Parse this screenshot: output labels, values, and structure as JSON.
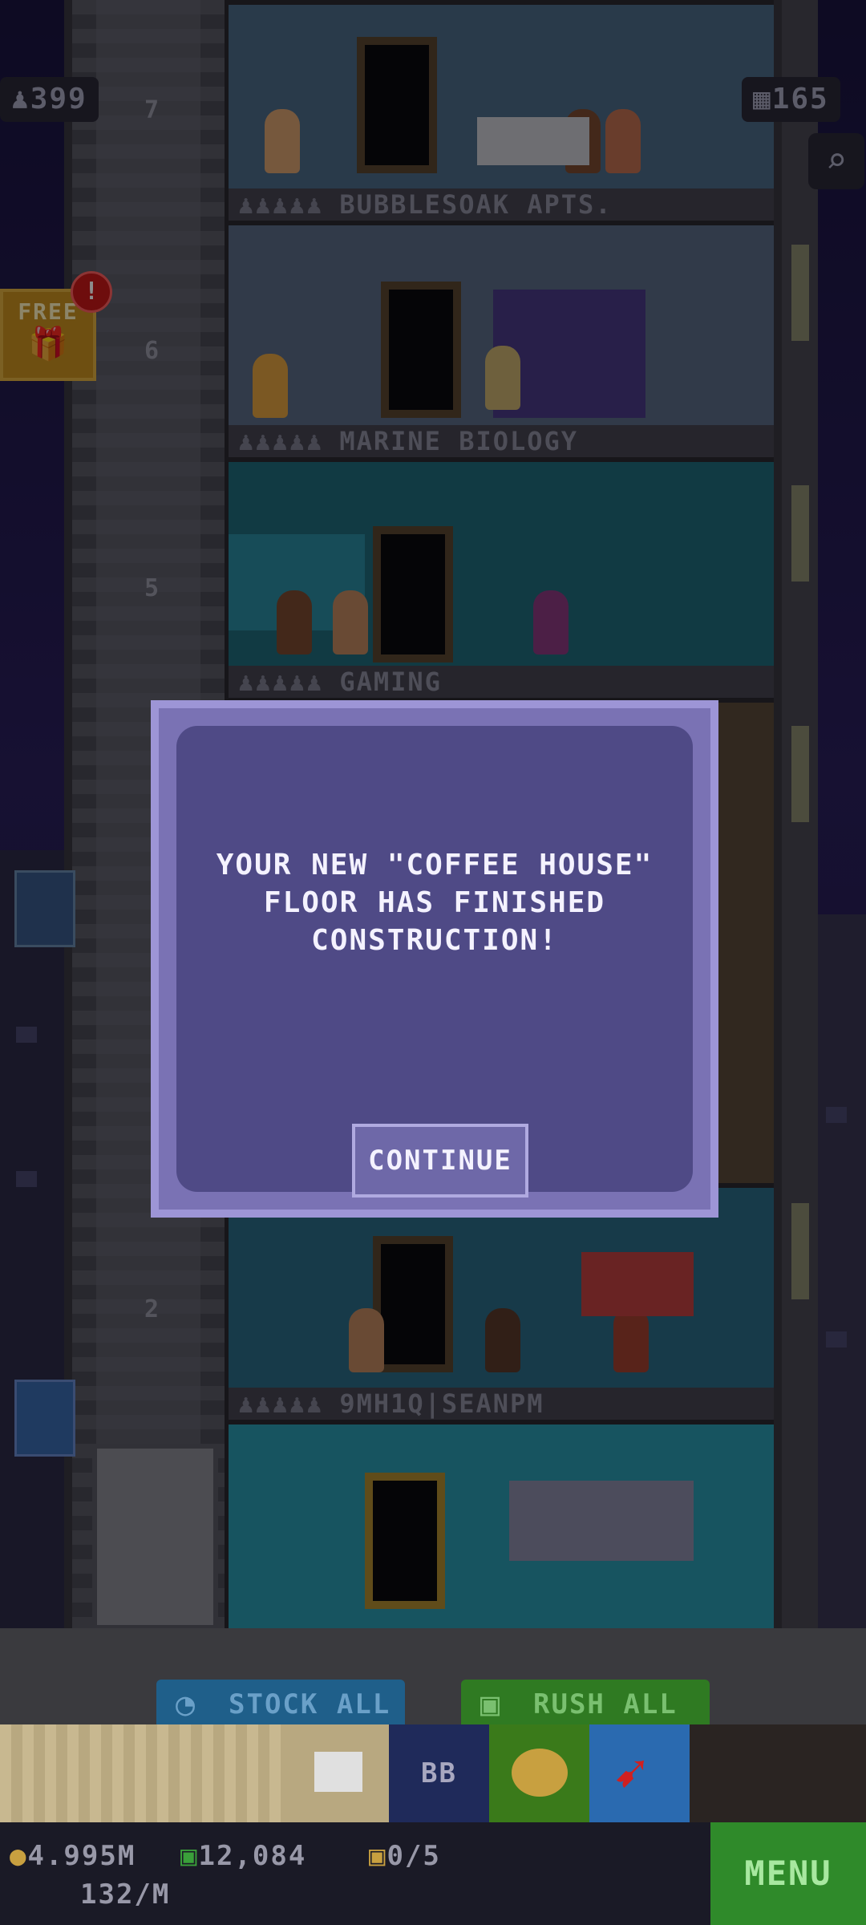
{
  "hud": {
    "population": "399",
    "bux": "165"
  },
  "free_gift": {
    "label": "FREE",
    "alert": "!"
  },
  "floors": [
    {
      "number": "7",
      "label": "BUBBLESOAK APTS."
    },
    {
      "number": "6",
      "label": "MARINE BIOLOGY"
    },
    {
      "number": "5",
      "label": "GAMING"
    },
    {
      "number": "2",
      "label": "9MH1Q|SEANPM"
    }
  ],
  "dialog": {
    "message": "YOUR NEW \"COFFEE HOUSE\"\nFLOOR HAS FINISHED\nCONSTRUCTION!",
    "continue_label": "CONTINUE"
  },
  "actions": {
    "stock_all": "STOCK ALL",
    "rush_all": "RUSH ALL"
  },
  "tray": {
    "bb_label": "BB"
  },
  "status": {
    "coins": "4.995M",
    "bux_count": "12,084",
    "vip": "0/5",
    "rate": "132/M"
  },
  "menu_label": "MENU",
  "colors": {
    "stock_btn": "#1f5f8a",
    "rush_btn": "#2f7a22",
    "dialog_bg": "#4f4a86"
  }
}
